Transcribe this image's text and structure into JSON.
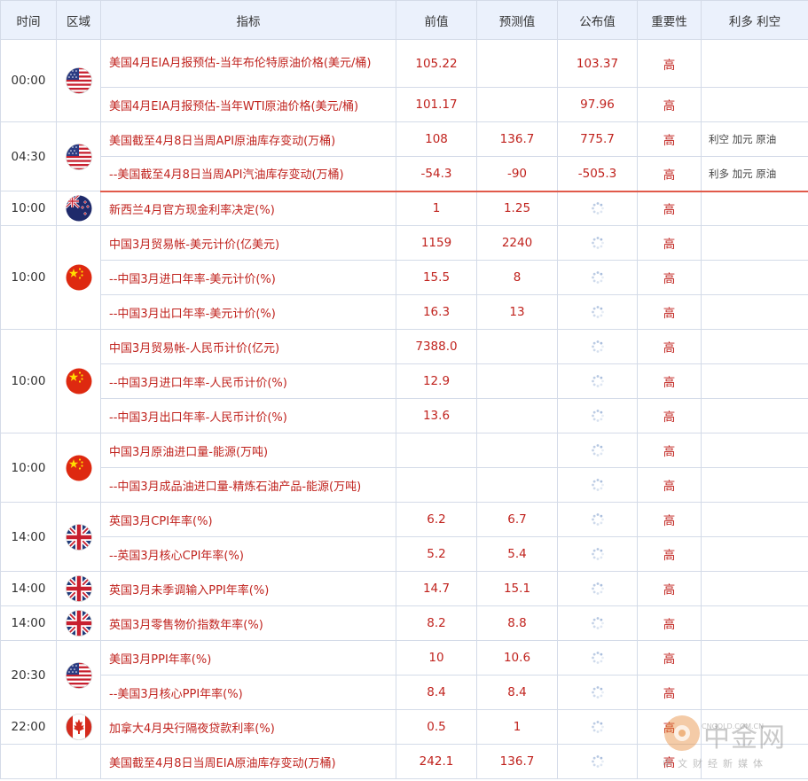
{
  "headers": {
    "time": "时间",
    "region": "区域",
    "indicator": "指标",
    "previous": "前值",
    "forecast": "预测值",
    "actual": "公布值",
    "importance": "重要性",
    "effect": "利多 利空"
  },
  "rows": {
    "r0": {
      "time": "00:00",
      "flag": "us-flag-icon",
      "indicator": "美国4月EIA月报预估-当年布伦特原油价格(美元/桶)",
      "previous": "105.22",
      "forecast": "",
      "actual": "103.37",
      "importance": "高",
      "effect": ""
    },
    "r1": {
      "indicator": "美国4月EIA月报预估-当年WTI原油价格(美元/桶)",
      "previous": "101.17",
      "forecast": "",
      "actual": "97.96",
      "importance": "高",
      "effect": ""
    },
    "r2": {
      "time": "04:30",
      "flag": "us-flag-icon",
      "indicator": "美国截至4月8日当周API原油库存变动(万桶)",
      "previous": "108",
      "forecast": "136.7",
      "actual": "775.7",
      "importance": "高",
      "effect": "利空  加元 原油"
    },
    "r3": {
      "indicator": "--美国截至4月8日当周API汽油库存变动(万桶)",
      "previous": "-54.3",
      "forecast": "-90",
      "actual": "-505.3",
      "importance": "高",
      "effect": "利多  加元 原油"
    },
    "r4": {
      "time": "10:00",
      "flag": "nz-flag-icon",
      "indicator": "新西兰4月官方现金利率决定(%)",
      "previous": "1",
      "forecast": "1.25",
      "importance": "高"
    },
    "r5": {
      "time": "10:00",
      "flag": "cn-flag-icon",
      "indicator": "中国3月贸易帐-美元计价(亿美元)",
      "previous": "1159",
      "forecast": "2240",
      "importance": "高"
    },
    "r6": {
      "indicator": "--中国3月进口年率-美元计价(%)",
      "previous": "15.5",
      "forecast": "8",
      "importance": "高"
    },
    "r7": {
      "indicator": "--中国3月出口年率-美元计价(%)",
      "previous": "16.3",
      "forecast": "13",
      "importance": "高"
    },
    "r8": {
      "time": "10:00",
      "flag": "cn-flag-icon",
      "indicator": "中国3月贸易帐-人民币计价(亿元)",
      "previous": "7388.0",
      "forecast": "",
      "importance": "高"
    },
    "r9": {
      "indicator": "--中国3月进口年率-人民币计价(%)",
      "previous": "12.9",
      "forecast": "",
      "importance": "高"
    },
    "r10": {
      "indicator": "--中国3月出口年率-人民币计价(%)",
      "previous": "13.6",
      "forecast": "",
      "importance": "高"
    },
    "r11": {
      "time": "10:00",
      "flag": "cn-flag-icon",
      "indicator": "中国3月原油进口量-能源(万吨)",
      "previous": "",
      "forecast": "",
      "importance": "高"
    },
    "r12": {
      "indicator": "--中国3月成品油进口量-精炼石油产品-能源(万吨)",
      "previous": "",
      "forecast": "",
      "importance": "高"
    },
    "r13": {
      "time": "14:00",
      "flag": "uk-flag-icon",
      "indicator": "英国3月CPI年率(%)",
      "previous": "6.2",
      "forecast": "6.7",
      "importance": "高"
    },
    "r14": {
      "indicator": "--英国3月核心CPI年率(%)",
      "previous": "5.2",
      "forecast": "5.4",
      "importance": "高"
    },
    "r15": {
      "time": "14:00",
      "flag": "uk-flag-icon",
      "indicator": "英国3月未季调输入PPI年率(%)",
      "previous": "14.7",
      "forecast": "15.1",
      "importance": "高"
    },
    "r16": {
      "time": "14:00",
      "flag": "uk-flag-icon",
      "indicator": "英国3月零售物价指数年率(%)",
      "previous": "8.2",
      "forecast": "8.8",
      "importance": "高"
    },
    "r17": {
      "time": "20:30",
      "flag": "us-flag-icon",
      "indicator": "美国3月PPI年率(%)",
      "previous": "10",
      "forecast": "10.6",
      "importance": "高"
    },
    "r18": {
      "indicator": "--美国3月核心PPI年率(%)",
      "previous": "8.4",
      "forecast": "8.4",
      "importance": "高"
    },
    "r19": {
      "time": "22:00",
      "flag": "ca-flag-icon",
      "indicator": "加拿大4月央行隔夜贷款利率(%)",
      "previous": "0.5",
      "forecast": "1",
      "importance": "高"
    },
    "r20": {
      "indicator": "美国截至4月8日当周EIA原油库存变动(万桶)",
      "previous": "242.1",
      "forecast": "136.7",
      "importance": "高"
    }
  },
  "watermark": {
    "title": "中金网",
    "domain": "CNGOLD.COM.CN",
    "slogan": "中文财经新媒体"
  },
  "colors": {
    "header_bg": "#ebf1fc",
    "value_red": "#c0221d",
    "border": "#d4dbe8",
    "separator": "#e15a4a"
  }
}
